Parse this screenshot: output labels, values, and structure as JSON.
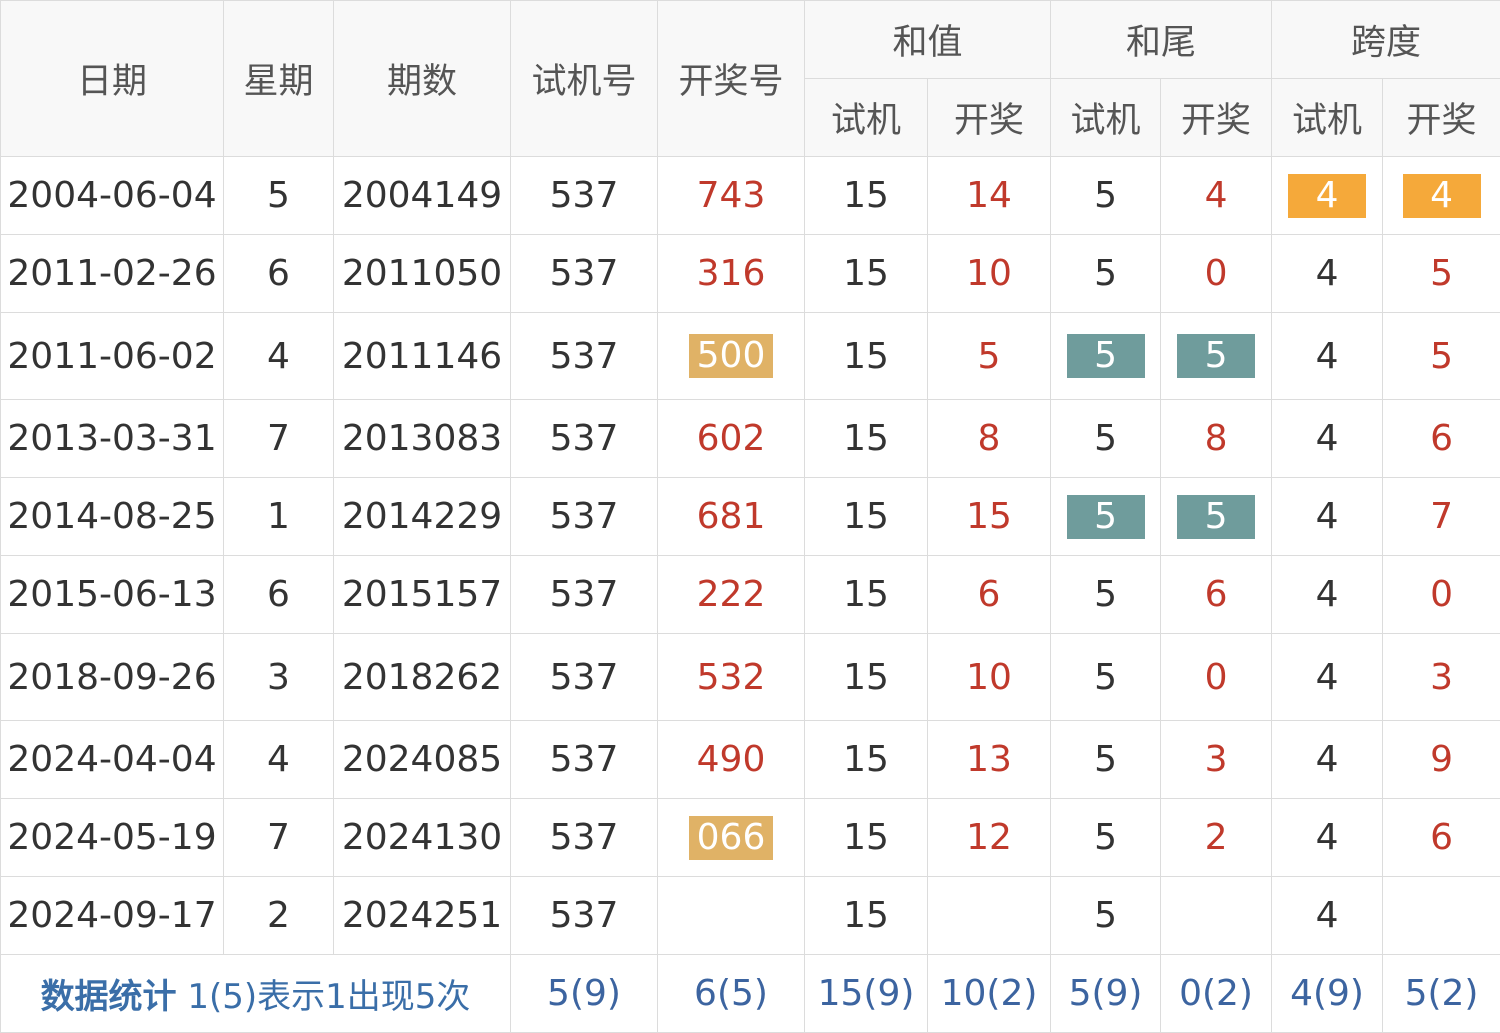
{
  "headers": {
    "date": "日期",
    "weekday": "星期",
    "issue": "期数",
    "trial": "试机号",
    "draw": "开奖号",
    "sum": "和值",
    "tail": "和尾",
    "span": "跨度",
    "sub_trial": "试机",
    "sub_draw": "开奖"
  },
  "rows": [
    {
      "date": "2004-06-04",
      "weekday": "5",
      "issue": "2004149",
      "trial": "537",
      "draw": "743",
      "sum_trial": "15",
      "sum_draw": "14",
      "tail_trial": "5",
      "tail_draw": "4",
      "span_trial": "4",
      "span_draw": "4"
    },
    {
      "date": "2011-02-26",
      "weekday": "6",
      "issue": "2011050",
      "trial": "537",
      "draw": "316",
      "sum_trial": "15",
      "sum_draw": "10",
      "tail_trial": "5",
      "tail_draw": "0",
      "span_trial": "4",
      "span_draw": "5"
    },
    {
      "date": "2011-06-02",
      "weekday": "4",
      "issue": "2011146",
      "trial": "537",
      "draw": "500",
      "sum_trial": "15",
      "sum_draw": "5",
      "tail_trial": "5",
      "tail_draw": "5",
      "span_trial": "4",
      "span_draw": "5"
    },
    {
      "date": "2013-03-31",
      "weekday": "7",
      "issue": "2013083",
      "trial": "537",
      "draw": "602",
      "sum_trial": "15",
      "sum_draw": "8",
      "tail_trial": "5",
      "tail_draw": "8",
      "span_trial": "4",
      "span_draw": "6"
    },
    {
      "date": "2014-08-25",
      "weekday": "1",
      "issue": "2014229",
      "trial": "537",
      "draw": "681",
      "sum_trial": "15",
      "sum_draw": "15",
      "tail_trial": "5",
      "tail_draw": "5",
      "span_trial": "4",
      "span_draw": "7"
    },
    {
      "date": "2015-06-13",
      "weekday": "6",
      "issue": "2015157",
      "trial": "537",
      "draw": "222",
      "sum_trial": "15",
      "sum_draw": "6",
      "tail_trial": "5",
      "tail_draw": "6",
      "span_trial": "4",
      "span_draw": "0"
    },
    {
      "date": "2018-09-26",
      "weekday": "3",
      "issue": "2018262",
      "trial": "537",
      "draw": "532",
      "sum_trial": "15",
      "sum_draw": "10",
      "tail_trial": "5",
      "tail_draw": "0",
      "span_trial": "4",
      "span_draw": "3"
    },
    {
      "date": "2024-04-04",
      "weekday": "4",
      "issue": "2024085",
      "trial": "537",
      "draw": "490",
      "sum_trial": "15",
      "sum_draw": "13",
      "tail_trial": "5",
      "tail_draw": "3",
      "span_trial": "4",
      "span_draw": "9"
    },
    {
      "date": "2024-05-19",
      "weekday": "7",
      "issue": "2024130",
      "trial": "537",
      "draw": "066",
      "sum_trial": "15",
      "sum_draw": "12",
      "tail_trial": "5",
      "tail_draw": "2",
      "span_trial": "4",
      "span_draw": "6"
    },
    {
      "date": "2024-09-17",
      "weekday": "2",
      "issue": "2024251",
      "trial": "537",
      "draw": "",
      "sum_trial": "15",
      "sum_draw": "",
      "tail_trial": "5",
      "tail_draw": "",
      "span_trial": "4",
      "span_draw": ""
    }
  ],
  "stats": {
    "title": "数据统计",
    "desc": "1(5)表示1出现5次",
    "trial": "5(9)",
    "draw": "6(5)",
    "sum_trial": "15(9)",
    "sum_draw": "10(2)",
    "tail_trial": "5(9)",
    "tail_draw": "0(2)",
    "span_trial": "4(9)",
    "span_draw": "5(2)"
  },
  "colors": {
    "draw_text": "#c0392b",
    "highlight_orange": "#f5a93a",
    "highlight_gold": "#e0b266",
    "highlight_teal": "#6f9c9c",
    "stat_text": "#3a6ea8"
  }
}
